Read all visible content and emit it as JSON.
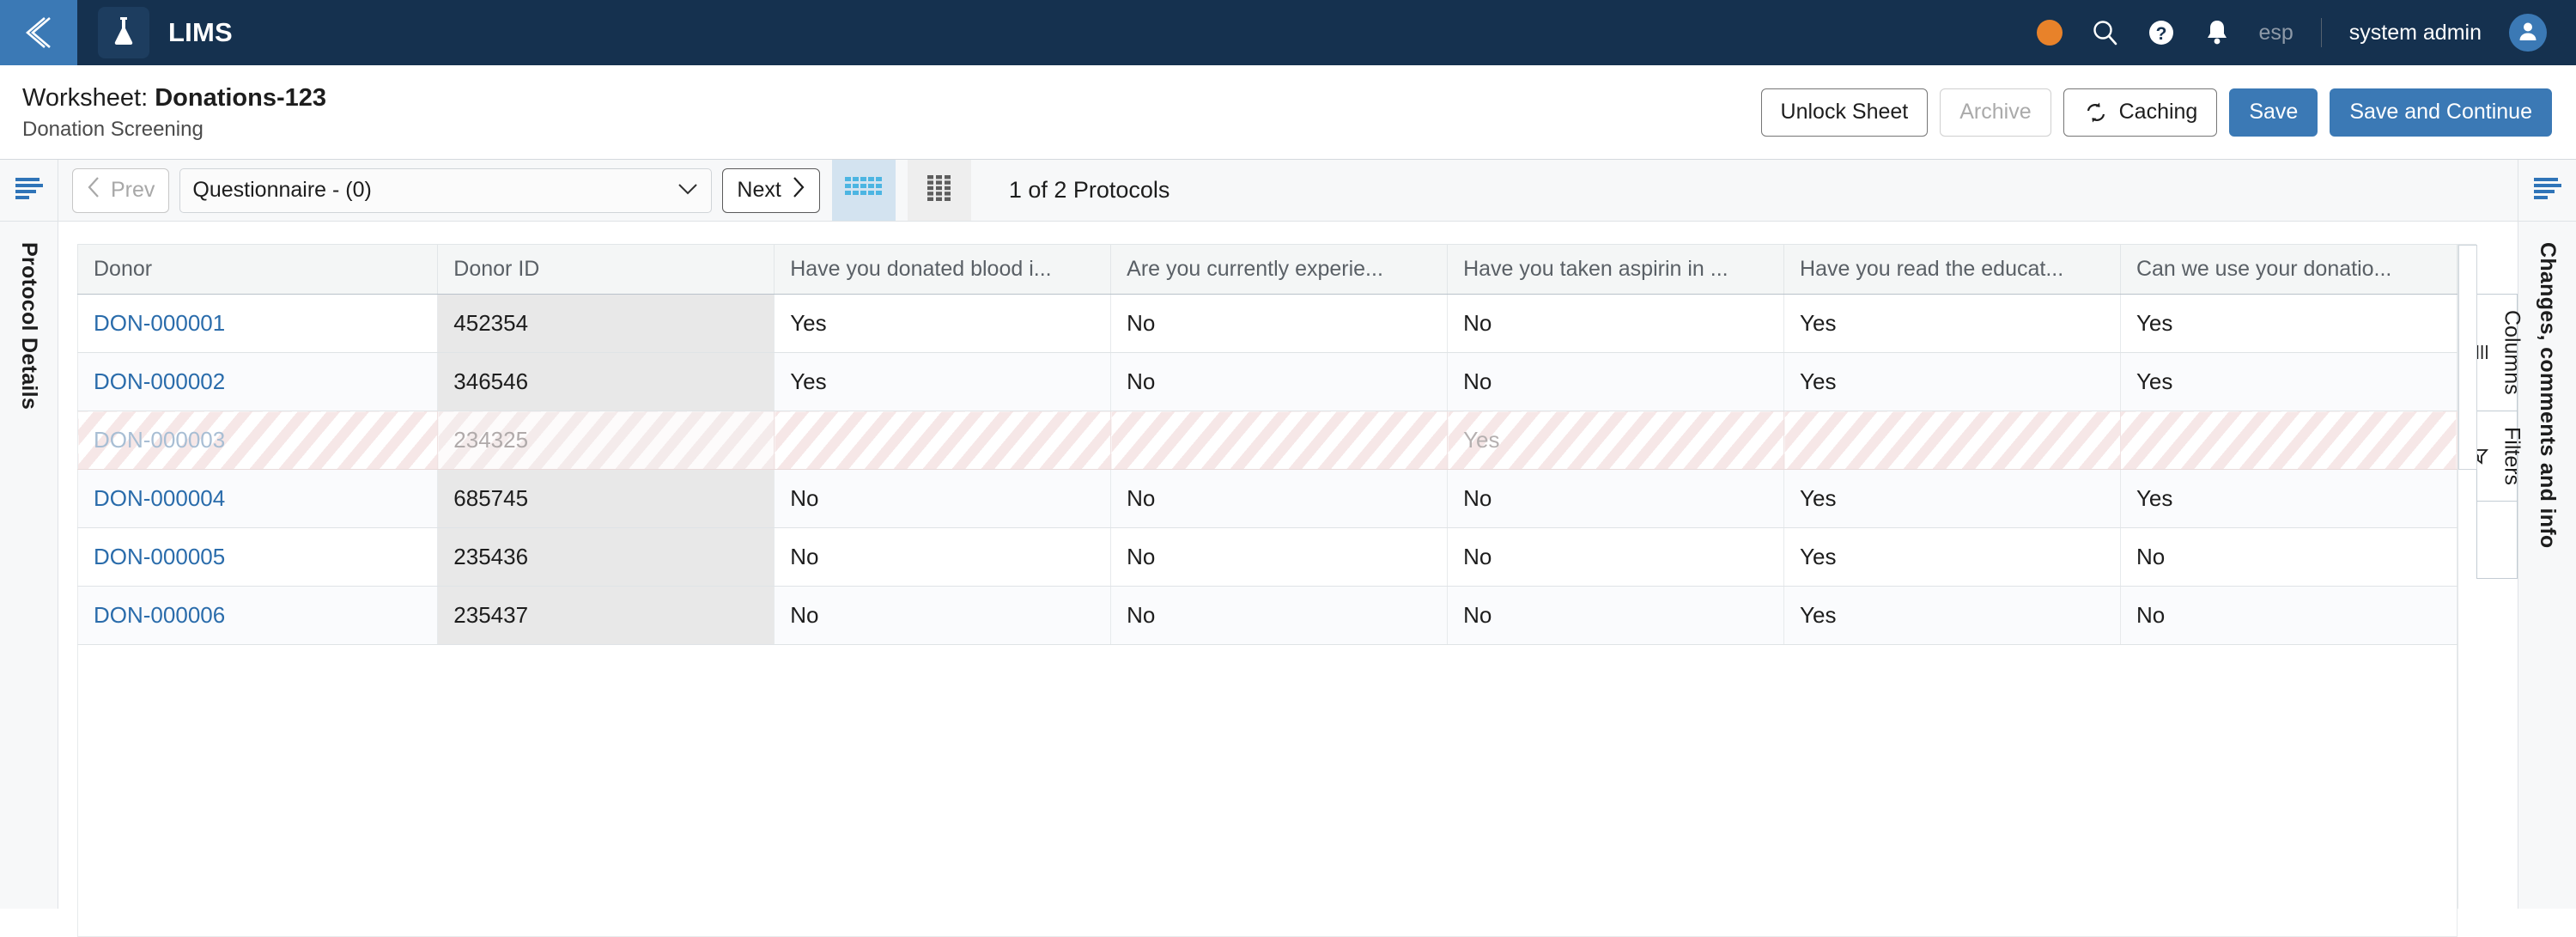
{
  "topbar": {
    "back_icon": "chevron-double-left-icon",
    "logo_icon": "flask-icon",
    "app_title": "LIMS",
    "status_icon": "status-dot-orange",
    "search_icon": "search-icon",
    "help_icon": "help-circle-icon",
    "notifications_icon": "bell-icon",
    "language": "esp",
    "username": "system admin",
    "avatar_icon": "user-avatar-icon"
  },
  "titlebar": {
    "prefix": "Worksheet:",
    "name": "Donations-123",
    "subtitle": "Donation Screening",
    "actions": {
      "unlock": "Unlock Sheet",
      "archive": "Archive",
      "caching": "Caching",
      "caching_icon": "refresh-sync-icon",
      "save": "Save",
      "save_continue": "Save and Continue"
    }
  },
  "toolbar": {
    "left_menu_icon": "hamburger-menu-icon",
    "right_menu_icon": "hamburger-menu-icon",
    "prev": "Prev",
    "next": "Next",
    "prev_icon": "chevron-left-icon",
    "next_icon": "chevron-right-icon",
    "protocol_selected": "Questionnaire - (0)",
    "caret_icon": "chevron-down-icon",
    "view_grid_dense_icon": "grid-dense-icon",
    "view_grid_card_icon": "grid-card-icon",
    "protocol_count": "1 of 2 Protocols"
  },
  "left_rail": {
    "label": "Protocol Details"
  },
  "right_rail": {
    "label": "Changes, comments and info"
  },
  "side_tabs": [
    {
      "label": "Columns",
      "icon": "columns-icon"
    },
    {
      "label": "Filters",
      "icon": "filter-funnel-icon"
    }
  ],
  "table": {
    "columns": [
      "Donor",
      "Donor ID",
      "Have you donated blood i...",
      "Are you currently experie...",
      "Have you taken aspirin in ...",
      "Have you read the educat...",
      "Can we use your donatio..."
    ],
    "rows": [
      {
        "donor": "DON-000001",
        "donor_id": "452354",
        "q1": "Yes",
        "q2": "No",
        "q3": "No",
        "q4": "Yes",
        "q5": "Yes",
        "disabled": false
      },
      {
        "donor": "DON-000002",
        "donor_id": "346546",
        "q1": "Yes",
        "q2": "No",
        "q3": "No",
        "q4": "Yes",
        "q5": "Yes",
        "disabled": false
      },
      {
        "donor": "DON-000003",
        "donor_id": "234325",
        "q1": "",
        "q2": "",
        "q3": "Yes",
        "q4": "",
        "q5": "",
        "disabled": true
      },
      {
        "donor": "DON-000004",
        "donor_id": "685745",
        "q1": "No",
        "q2": "No",
        "q3": "No",
        "q4": "Yes",
        "q5": "Yes",
        "disabled": false
      },
      {
        "donor": "DON-000005",
        "donor_id": "235436",
        "q1": "No",
        "q2": "No",
        "q3": "No",
        "q4": "Yes",
        "q5": "No",
        "disabled": false
      },
      {
        "donor": "DON-000006",
        "donor_id": "235437",
        "q1": "No",
        "q2": "No",
        "q3": "No",
        "q4": "Yes",
        "q5": "No",
        "disabled": false
      }
    ]
  },
  "colors": {
    "navbar": "#15314f",
    "accent_blue": "#3b79b5",
    "link_blue": "#2a6cab",
    "status_orange": "#e8822a",
    "disabled_stripe": "#f6e7e7"
  }
}
